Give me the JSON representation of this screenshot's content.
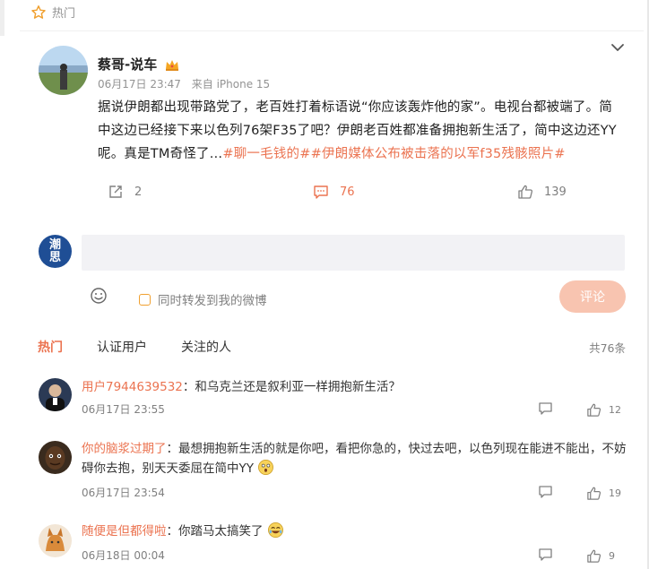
{
  "section": {
    "label": "热门"
  },
  "post": {
    "author": "蔡哥-说车",
    "time": "06月17日 23:47",
    "source": "来自 iPhone 15",
    "text": "据说伊朗都出现带路党了，老百姓打着标语说“你应该轰炸他的家”。电视台都被端了。简中这边已经接下来以色列76架F35了吧？伊朗老百姓都准备拥抱新生活了，简中这边还YY呢。真是TM奇怪了…",
    "hashtags": [
      "#聊一毛钱的#",
      "#伊朗媒体公布被击落的以军f35残骸照片#"
    ],
    "forward_count": "2",
    "comment_count": "76",
    "like_count": "139"
  },
  "reply_box": {
    "avatar_text": "潮思",
    "input_value": "",
    "placeholder": "",
    "forward_label": "同时转发到我的微博",
    "submit_label": "评论"
  },
  "tabs": [
    {
      "label": "热门",
      "active": true
    },
    {
      "label": "认证用户",
      "active": false
    },
    {
      "label": "关注的人",
      "active": false
    }
  ],
  "total": "共76条",
  "comments": [
    {
      "user": "用户7944639532",
      "text": "：和乌克兰还是叙利亚一样拥抱新生活？",
      "time": "06月17日 23:55",
      "likes": "12"
    },
    {
      "user": "你的脑浆过期了",
      "text": "：最想拥抱新生活的就是你吧，看把你急的，快过去吧，以色列现在能进不能出，不妨碍你去抱，别天天委屈在简中YY",
      "time": "06月17日 23:54",
      "likes": "19"
    },
    {
      "user": "随便是但都得啦",
      "text": "：你踏马太搞笑了",
      "time": "06月18日 00:04",
      "likes": "9"
    }
  ],
  "colors": {
    "accent": "#eb7350",
    "muted": "#939393",
    "submit_disabled": "#f8c4b0"
  },
  "icons": [
    "fire-icon",
    "crown-icon",
    "chevron-down-icon",
    "forward-icon",
    "comment-icon",
    "like-icon",
    "emoji-icon",
    "reply-icon",
    "surprised-emoji",
    "laughing-emoji"
  ]
}
